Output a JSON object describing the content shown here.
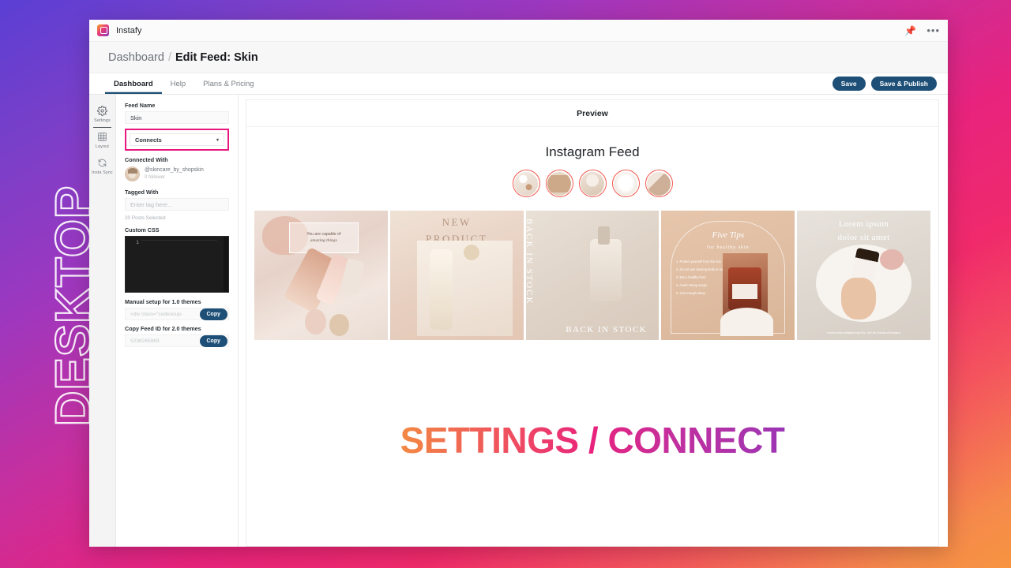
{
  "overlay": {
    "side_label": "DESKTOP"
  },
  "titlebar": {
    "app_name": "Instafy",
    "app_icon": "instagram-app-icon",
    "pin_icon": "pin-icon",
    "more_icon": "more-options-icon"
  },
  "breadcrumb": {
    "root": "Dashboard",
    "separator": "/",
    "current": "Edit Feed: Skin"
  },
  "tabs": [
    {
      "label": "Dashboard",
      "active": true
    },
    {
      "label": "Help",
      "active": false
    },
    {
      "label": "Plans & Pricing",
      "active": false
    }
  ],
  "actions": {
    "save": "Save",
    "save_publish": "Save & Publish"
  },
  "rail": [
    {
      "label": "Settings",
      "icon": "gear-icon",
      "active": true
    },
    {
      "label": "Layout",
      "icon": "grid-layout-icon",
      "active": false
    },
    {
      "label": "Insta Sync",
      "icon": "refresh-sync-icon",
      "active": false
    }
  ],
  "settings": {
    "feed_name_label": "Feed Name",
    "feed_name_value": "Skin",
    "source_value": "Connects",
    "source_caret": "▾",
    "connected_label": "Connected With",
    "account_handle": "@skincare_by_shopskin",
    "account_followers": "0 follower",
    "tagged_label": "Tagged With",
    "tag_placeholder": "Enter tag here...",
    "posts_selected": "20 Posts Selected",
    "custom_css_label": "Custom CSS",
    "css_line_number": "1",
    "manual_setup_label": "Manual setup for 1.0 themes",
    "manual_setup_value": "<div class=\"codesoup-",
    "feed_id_label": "Copy Feed ID for 2.0 themes",
    "feed_id_value": "5236265963",
    "copy_label": "Copy",
    "highlight_color": "#e8187f"
  },
  "preview": {
    "header": "Preview",
    "feed_title": "Instagram Feed",
    "stories": [
      {
        "name": "story-1"
      },
      {
        "name": "story-2"
      },
      {
        "name": "story-3"
      },
      {
        "name": "story-4"
      },
      {
        "name": "story-5"
      }
    ],
    "tiles": [
      {
        "name": "post-quote-book",
        "caption_top": "You are capable of",
        "caption_sub": "amazing things"
      },
      {
        "name": "post-new-product",
        "caption_top": "NEW",
        "caption_sub": "PRODUCT"
      },
      {
        "name": "post-back-in-stock",
        "caption_top": "BACK IN STOCK",
        "caption_sub": "BACK IN STOCK"
      },
      {
        "name": "post-five-tips",
        "caption_top": "Five Tips",
        "caption_sub": "for healthy skin"
      },
      {
        "name": "post-lorem-ipsum",
        "caption_top": "Lorem ipsum",
        "caption_sub": "dolor sit amet",
        "caption_foot": "consectetur adipiscing elit, sed do eiusmod tempor"
      }
    ],
    "five_tips_items": [
      "1.  Protect yourself from the sun",
      "2.  Do not use tanning beds or sunlamps",
      "3.  Eat a healthy food",
      "4.  Avoid strong soaps",
      "5.  Get enough sleep"
    ]
  },
  "caption": {
    "part_a": "SETTINGS",
    "part_b": " / ",
    "part_c": "CONNECT"
  }
}
